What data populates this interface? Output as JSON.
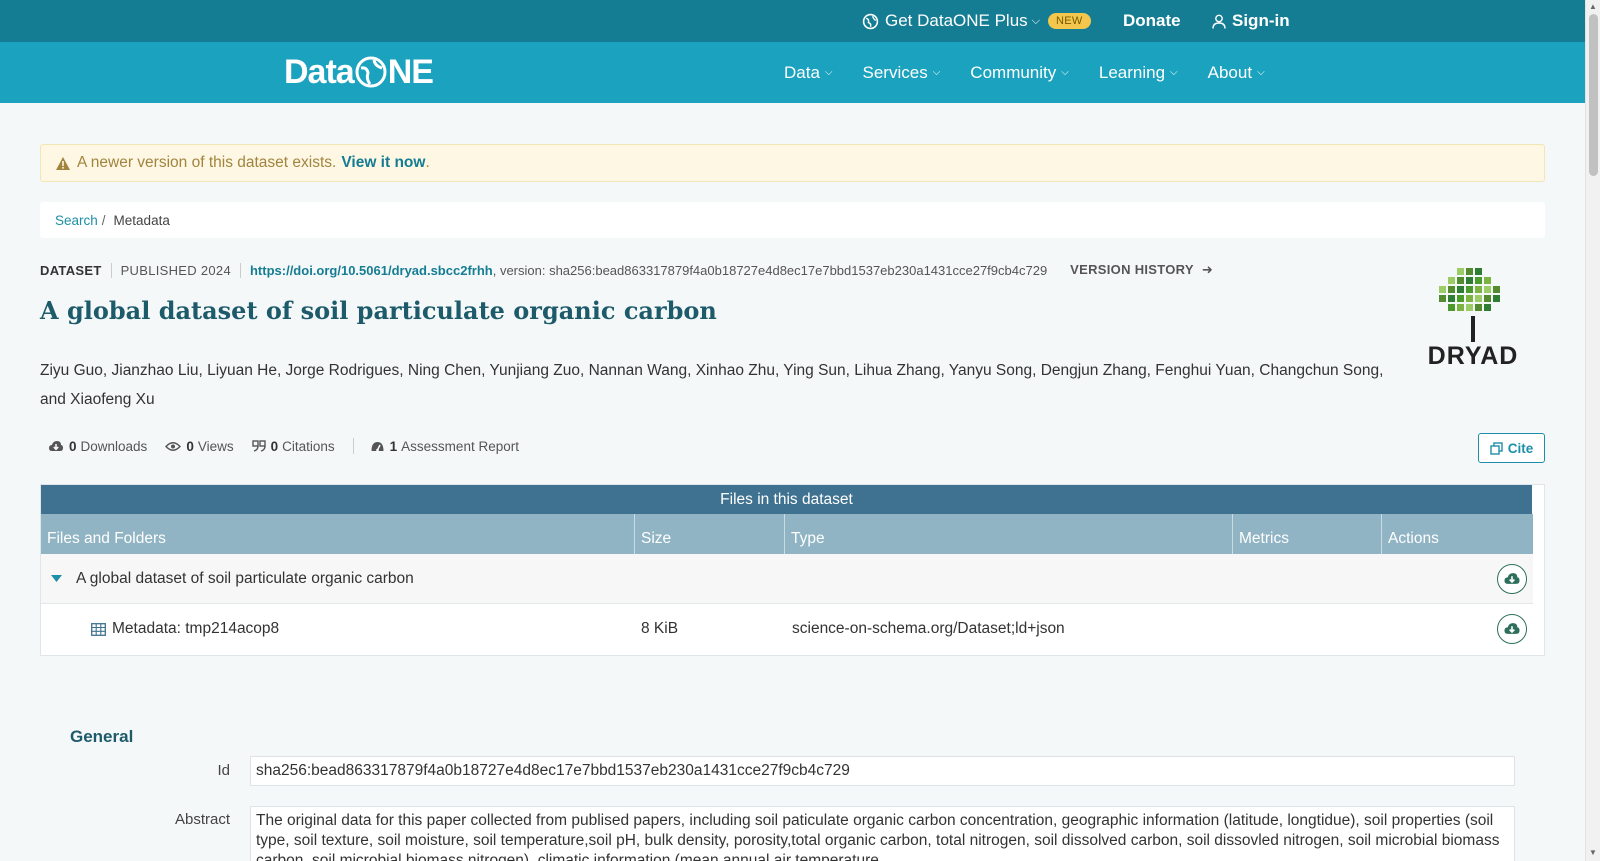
{
  "topbar": {
    "plus_label": "Get DataONE Plus",
    "new_badge": "NEW",
    "donate": "Donate",
    "signin": "Sign-in"
  },
  "nav": {
    "logo": {
      "pre": "Data",
      "post": "NE"
    },
    "items": [
      "Data",
      "Services",
      "Community",
      "Learning",
      "About"
    ]
  },
  "alert": {
    "text": "A newer version of this dataset exists.",
    "link": "View it now",
    "end": "."
  },
  "breadcrumb": {
    "search": "Search",
    "sep": "/",
    "current": "Metadata"
  },
  "dataset": {
    "type": "DATASET",
    "published": "PUBLISHED 2024",
    "doi": "https://doi.org/10.5061/dryad.sbcc2frhh",
    "version": ", version: sha256:bead863317879f4a0b18727e4d8ec17e7bbd1537eb230a1431cce27f9cb4c729",
    "version_history": "VERSION HISTORY",
    "title": "A global dataset of soil particulate organic carbon",
    "authors": "Ziyu Guo, Jianzhao Liu, Liyuan He, Jorge Rodrigues, Ning Chen, Yunjiang Zuo, Nannan Wang, Xinhao Zhu, Ying Sun, Lihua Zhang, Yanyu Song, Dengjun Zhang, Fenghui Yuan, Changchun Song, and Xiaofeng Xu",
    "repo_logo": "DRYAD"
  },
  "stats": {
    "downloads_count": "0",
    "downloads_label": "Downloads",
    "views_count": "0",
    "views_label": "Views",
    "citations_count": "0",
    "citations_label": "Citations",
    "reports_count": "1",
    "reports_label": "Assessment Report"
  },
  "cite": "Cite",
  "files": {
    "heading": "Files in this dataset",
    "columns": [
      "Files and Folders",
      "Size",
      "Type",
      "Metrics",
      "Actions"
    ],
    "folder": "A global dataset of soil particulate organic carbon",
    "file": {
      "name": "Metadata: tmp214acop8",
      "size": "8 KiB",
      "type": "science-on-schema.org/Dataset;ld+json"
    }
  },
  "general": {
    "heading": "General",
    "id_label": "Id",
    "id_value": "sha256:bead863317879f4a0b18727e4d8ec17e7bbd1537eb230a1431cce27f9cb4c729",
    "abstract_label": "Abstract",
    "abstract_value": "The original data for this paper collected from publised papers, including soil paticulate organic carbon concentration, geographic information (latitude, longtidue), soil properties (soil type, soil texture, soil moisture, soil temperature,soil pH, bulk density, porosity,total organic carbon, total nitrogen, soil dissolved carbon, soil dissovled nitrogen, soil microbial biomass carbon, soil microbial biomass nitrogen), climatic information (mean annual air temperature"
  },
  "colors": {
    "topbar": "#157d93",
    "navbar": "#1aa2be",
    "accent": "#157d93",
    "title": "#1d5b6b"
  }
}
